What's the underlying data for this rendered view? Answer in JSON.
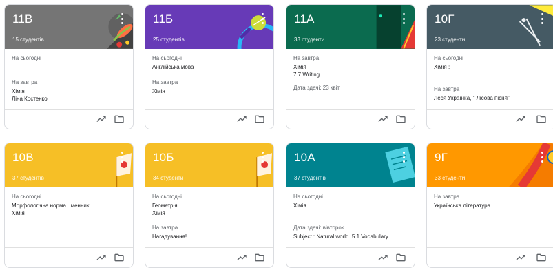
{
  "cards": [
    {
      "title": "11В",
      "count": "15 студентів",
      "color": "#757575",
      "today_label": "На сьогодні",
      "today_items": [],
      "tomorrow_label": "На завтра",
      "tomorrow_items": [
        "Хімія",
        "Ліна Костенко"
      ]
    },
    {
      "title": "11Б",
      "count": "25 студентів",
      "color": "#673ab7",
      "today_label": "На сьогодні",
      "today_items": [
        "Англійська мова"
      ],
      "tomorrow_label": "На завтра",
      "tomorrow_items": [
        "Хімія"
      ]
    },
    {
      "title": "11А",
      "count": "33 студенти",
      "color": "#0b6b4f",
      "today_label": "На завтра",
      "today_items": [
        "Хімія",
        "7.7 Writing"
      ],
      "tomorrow_label": "Дата здачі: 23 квіт.",
      "tomorrow_items": []
    },
    {
      "title": "10Г",
      "count": "23 студенти",
      "color": "#455a64",
      "today_label": "На сьогодні",
      "today_items": [
        "Хімія :"
      ],
      "tomorrow_label": "На завтра",
      "tomorrow_items": [
        "Леся Українка, \" Лісова пісня\""
      ]
    },
    {
      "title": "10В",
      "count": "37 студентів",
      "color": "#f6bf26",
      "today_label": "На сьогодні",
      "today_items": [
        "Морфологічна норма. Іменник",
        "Хімія"
      ],
      "tomorrow_label": "",
      "tomorrow_items": []
    },
    {
      "title": "10Б",
      "count": "34 студенти",
      "color": "#f6bf26",
      "today_label": "На сьогодні",
      "today_items": [
        "Геометрія",
        "Хімія"
      ],
      "tomorrow_label": "На завтра",
      "tomorrow_items": [
        "Нагадування!"
      ]
    },
    {
      "title": "10А",
      "count": "37 студентів",
      "color": "#00838f",
      "today_label": "На сьогодні",
      "today_items": [
        "Хімія"
      ],
      "tomorrow_label": "Дата здачі: вівторок",
      "tomorrow_items": [
        "Subject : Natural world. 5.1.Vocabulary."
      ]
    },
    {
      "title": "9Г",
      "count": "33 студенти",
      "color": "#ff9800",
      "today_label": "На завтра",
      "today_items": [
        "Українська література"
      ],
      "tomorrow_label": "",
      "tomorrow_items": []
    }
  ],
  "icons": {
    "trend": "trending-up-icon",
    "folder": "folder-icon",
    "menu": "more-vert-icon"
  }
}
